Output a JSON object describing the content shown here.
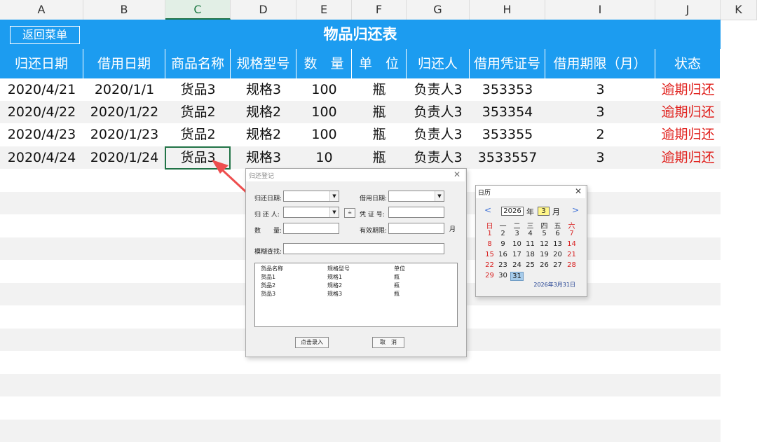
{
  "columns": [
    "A",
    "B",
    "C",
    "D",
    "E",
    "F",
    "G",
    "H",
    "I",
    "J",
    "K"
  ],
  "back_button": "返回菜单",
  "title": "物品归还表",
  "headers": [
    "归还日期",
    "借用日期",
    "商品名称",
    "规格型号",
    "数　量",
    "单　位",
    "归还人",
    "借用凭证号",
    "借用期限（月）",
    "状态"
  ],
  "rows": [
    [
      "2020/4/21",
      "2020/1/1",
      "货品3",
      "规格3",
      "100",
      "瓶",
      "负责人3",
      "353353",
      "3",
      "逾期归还"
    ],
    [
      "2020/4/22",
      "2020/1/22",
      "货品2",
      "规格2",
      "100",
      "瓶",
      "负责人3",
      "353354",
      "3",
      "逾期归还"
    ],
    [
      "2020/4/23",
      "2020/1/23",
      "货品2",
      "规格2",
      "100",
      "瓶",
      "负责人3",
      "353355",
      "2",
      "逾期归还"
    ],
    [
      "2020/4/24",
      "2020/1/24",
      "货品3",
      "规格3",
      "10",
      "瓶",
      "负责人3",
      "3533557",
      "3",
      "逾期归还"
    ]
  ],
  "dialog": {
    "title": "归还登记",
    "return_date_label": "归还日期:",
    "borrow_date_label": "借用日期:",
    "returner_label": "归 还 人:",
    "voucher_label": "凭 证 号:",
    "qty_label": "数　　量:",
    "valid_label": "有效期限:",
    "month_label": "月",
    "fuzzy_label": "模糊查找:",
    "list_headers": [
      "货品名称",
      "规格型号",
      "单位"
    ],
    "list_rows": [
      [
        "货品1",
        "规格1",
        "瓶"
      ],
      [
        "货品2",
        "规格2",
        "瓶"
      ],
      [
        "货品3",
        "规格3",
        "瓶"
      ]
    ],
    "enter_button": "点击录入",
    "cancel_button": "取　消"
  },
  "calendar": {
    "title": "日历",
    "year": "2026",
    "year_label": "年",
    "month": "3",
    "month_label": "月",
    "weekdays": [
      "日",
      "一",
      "二",
      "三",
      "四",
      "五",
      "六"
    ],
    "weeks": [
      [
        "1",
        "2",
        "3",
        "4",
        "5",
        "6",
        "7"
      ],
      [
        "8",
        "9",
        "10",
        "11",
        "12",
        "13",
        "14"
      ],
      [
        "15",
        "16",
        "17",
        "18",
        "19",
        "20",
        "21"
      ],
      [
        "22",
        "23",
        "24",
        "25",
        "26",
        "27",
        "28"
      ],
      [
        "29",
        "30",
        "31",
        "",
        "",
        "",
        ""
      ]
    ],
    "selected_day": "31",
    "today_text": "2026年3月31日"
  }
}
